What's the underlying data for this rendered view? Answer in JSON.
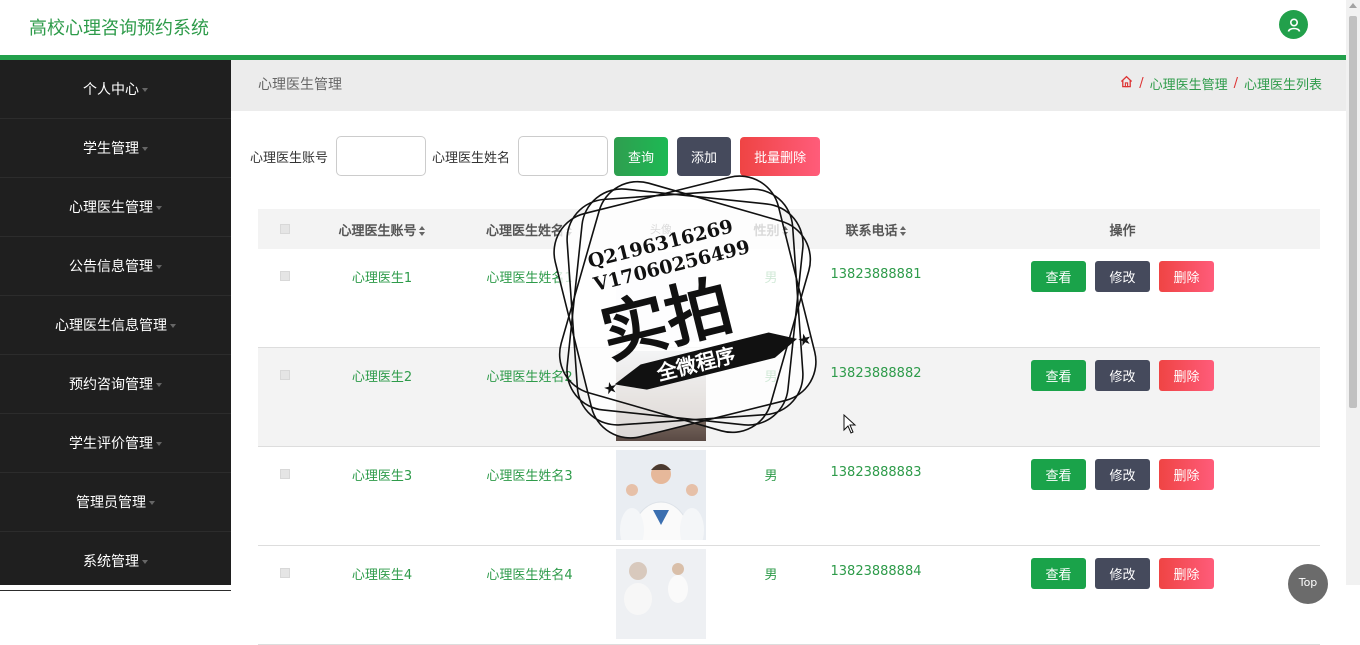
{
  "app": {
    "title": "高校心理咨询预约系统"
  },
  "sidebar": {
    "items": [
      {
        "label": "个人中心"
      },
      {
        "label": "学生管理"
      },
      {
        "label": "心理医生管理"
      },
      {
        "label": "公告信息管理"
      },
      {
        "label": "心理医生信息管理"
      },
      {
        "label": "预约咨询管理"
      },
      {
        "label": "学生评价管理"
      },
      {
        "label": "管理员管理"
      },
      {
        "label": "系统管理"
      }
    ]
  },
  "page": {
    "title": "心理医生管理",
    "breadcrumb": [
      "心理医生管理",
      "心理医生列表"
    ]
  },
  "search": {
    "account_label": "心理医生账号",
    "account_value": "",
    "name_label": "心理医生姓名",
    "name_value": "",
    "query_label": "查询",
    "add_label": "添加",
    "batch_delete_label": "批量删除"
  },
  "table": {
    "columns": [
      "心理医生账号",
      "心理医生姓名",
      "头像",
      "性别",
      "联系电话",
      "操作"
    ],
    "rows": [
      {
        "account": "心理医生1",
        "name": "心理医生姓名1",
        "sex": "男",
        "phone": "13823888881"
      },
      {
        "account": "心理医生2",
        "name": "心理医生姓名2",
        "sex": "男",
        "phone": "13823888882"
      },
      {
        "account": "心理医生3",
        "name": "心理医生姓名3",
        "sex": "男",
        "phone": "13823888883"
      },
      {
        "account": "心理医生4",
        "name": "心理医生姓名4",
        "sex": "男",
        "phone": "13823888884"
      }
    ],
    "ops": {
      "view": "查看",
      "edit": "修改",
      "delete": "删除"
    }
  },
  "watermark": {
    "line1": "Q2196316269",
    "line2": "V17060256499",
    "big": "实拍",
    "banner": "全微程序"
  },
  "top_button": "Top",
  "colors": {
    "accent": "#22a04b",
    "sidebar": "#1f1f1f",
    "danger": "#ef4444",
    "dark_button": "#454a5c"
  }
}
